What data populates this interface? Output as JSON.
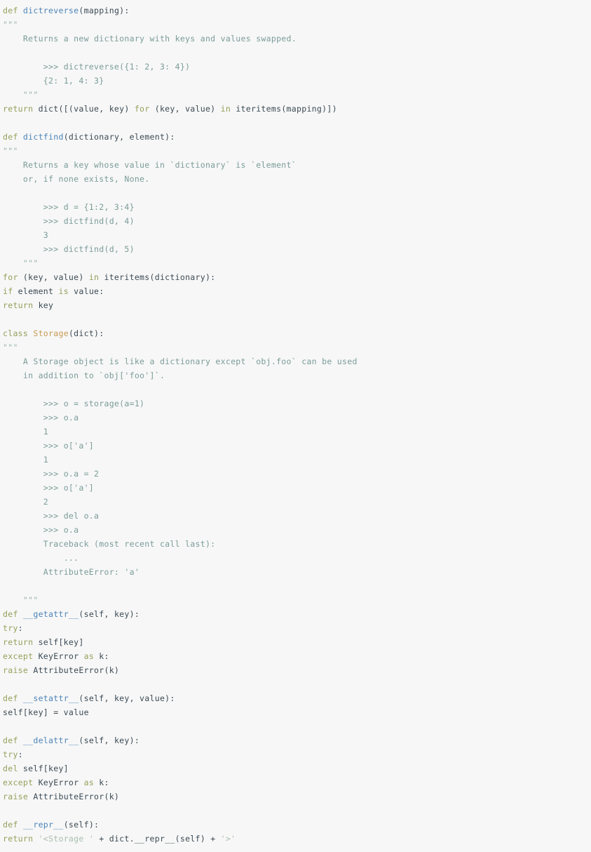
{
  "view": {
    "kind": "source-code-listing",
    "language": "python",
    "background_color": "#f7f7f7",
    "font_size_px": 11.5,
    "line_height_px": 20
  },
  "palette": {
    "keyword": "#94a15b",
    "function_name": "#4c84b8",
    "class_name": "#c99a53",
    "docstring": "#7a9c98",
    "triple_quote": "#9bb3b0",
    "string": "#a9bfae",
    "plain": "#3b4a54",
    "background": "#f7f7f7"
  },
  "code": {
    "lines": [
      {
        "id": 1,
        "indent": 0,
        "tokens": [
          {
            "t": "def",
            "c": "kw"
          },
          {
            "t": " ",
            "c": "pl"
          },
          {
            "t": "dictreverse",
            "c": "fn"
          },
          {
            "t": "(mapping):",
            "c": "pl"
          }
        ]
      },
      {
        "id": 2,
        "indent": 0,
        "tokens": [
          {
            "t": "\"\"\"",
            "c": "dq"
          }
        ]
      },
      {
        "id": 3,
        "indent": 4,
        "tokens": [
          {
            "t": "Returns a new dictionary with keys and values swapped.",
            "c": "doc"
          }
        ]
      },
      {
        "id": 4,
        "indent": 0,
        "tokens": []
      },
      {
        "id": 5,
        "indent": 8,
        "tokens": [
          {
            "t": ">>> dictreverse({1: 2, 3: 4})",
            "c": "doc"
          }
        ]
      },
      {
        "id": 6,
        "indent": 8,
        "tokens": [
          {
            "t": "{2: 1, 4: 3}",
            "c": "doc"
          }
        ]
      },
      {
        "id": 7,
        "indent": 4,
        "tokens": [
          {
            "t": "\"\"\"",
            "c": "dq"
          }
        ]
      },
      {
        "id": 8,
        "indent": 0,
        "tokens": [
          {
            "t": "return",
            "c": "kw"
          },
          {
            "t": " dict([(value, key) ",
            "c": "pl"
          },
          {
            "t": "for",
            "c": "kw"
          },
          {
            "t": " (key, value) ",
            "c": "pl"
          },
          {
            "t": "in",
            "c": "kw"
          },
          {
            "t": " iteritems(mapping)])",
            "c": "pl"
          }
        ]
      },
      {
        "id": 9,
        "indent": 0,
        "tokens": []
      },
      {
        "id": 10,
        "indent": 0,
        "tokens": [
          {
            "t": "def",
            "c": "kw"
          },
          {
            "t": " ",
            "c": "pl"
          },
          {
            "t": "dictfind",
            "c": "fn"
          },
          {
            "t": "(dictionary, element):",
            "c": "pl"
          }
        ]
      },
      {
        "id": 11,
        "indent": 0,
        "tokens": [
          {
            "t": "\"\"\"",
            "c": "dq"
          }
        ]
      },
      {
        "id": 12,
        "indent": 4,
        "tokens": [
          {
            "t": "Returns a key whose value in `dictionary` is `element`",
            "c": "doc"
          }
        ]
      },
      {
        "id": 13,
        "indent": 4,
        "tokens": [
          {
            "t": "or, if none exists, None.",
            "c": "doc"
          }
        ]
      },
      {
        "id": 14,
        "indent": 0,
        "tokens": []
      },
      {
        "id": 15,
        "indent": 8,
        "tokens": [
          {
            "t": ">>> d = {1:2, 3:4}",
            "c": "doc"
          }
        ]
      },
      {
        "id": 16,
        "indent": 8,
        "tokens": [
          {
            "t": ">>> dictfind(d, 4)",
            "c": "doc"
          }
        ]
      },
      {
        "id": 17,
        "indent": 8,
        "tokens": [
          {
            "t": "3",
            "c": "doc"
          }
        ]
      },
      {
        "id": 18,
        "indent": 8,
        "tokens": [
          {
            "t": ">>> dictfind(d, 5)",
            "c": "doc"
          }
        ]
      },
      {
        "id": 19,
        "indent": 4,
        "tokens": [
          {
            "t": "\"\"\"",
            "c": "dq"
          }
        ]
      },
      {
        "id": 20,
        "indent": 0,
        "tokens": [
          {
            "t": "for",
            "c": "kw"
          },
          {
            "t": " (key, value) ",
            "c": "pl"
          },
          {
            "t": "in",
            "c": "kw"
          },
          {
            "t": " iteritems(dictionary):",
            "c": "pl"
          }
        ]
      },
      {
        "id": 21,
        "indent": 0,
        "tokens": [
          {
            "t": "if",
            "c": "kw"
          },
          {
            "t": " element ",
            "c": "pl"
          },
          {
            "t": "is",
            "c": "kw"
          },
          {
            "t": " value:",
            "c": "pl"
          }
        ]
      },
      {
        "id": 22,
        "indent": 0,
        "tokens": [
          {
            "t": "return",
            "c": "kw"
          },
          {
            "t": " key",
            "c": "pl"
          }
        ]
      },
      {
        "id": 23,
        "indent": 0,
        "tokens": []
      },
      {
        "id": 24,
        "indent": 0,
        "tokens": [
          {
            "t": "class",
            "c": "kw"
          },
          {
            "t": " ",
            "c": "pl"
          },
          {
            "t": "Storage",
            "c": "cls"
          },
          {
            "t": "(dict):",
            "c": "pl"
          }
        ]
      },
      {
        "id": 25,
        "indent": 0,
        "tokens": [
          {
            "t": "\"\"\"",
            "c": "dq"
          }
        ]
      },
      {
        "id": 26,
        "indent": 4,
        "tokens": [
          {
            "t": "A Storage object is like a dictionary except `obj.foo` can be used",
            "c": "doc"
          }
        ]
      },
      {
        "id": 27,
        "indent": 4,
        "tokens": [
          {
            "t": "in addition to `obj['foo']`.",
            "c": "doc"
          }
        ]
      },
      {
        "id": 28,
        "indent": 0,
        "tokens": []
      },
      {
        "id": 29,
        "indent": 8,
        "tokens": [
          {
            "t": ">>> o = storage(a=1)",
            "c": "doc"
          }
        ]
      },
      {
        "id": 30,
        "indent": 8,
        "tokens": [
          {
            "t": ">>> o.a",
            "c": "doc"
          }
        ]
      },
      {
        "id": 31,
        "indent": 8,
        "tokens": [
          {
            "t": "1",
            "c": "doc"
          }
        ]
      },
      {
        "id": 32,
        "indent": 8,
        "tokens": [
          {
            "t": ">>> o['a']",
            "c": "doc"
          }
        ]
      },
      {
        "id": 33,
        "indent": 8,
        "tokens": [
          {
            "t": "1",
            "c": "doc"
          }
        ]
      },
      {
        "id": 34,
        "indent": 8,
        "tokens": [
          {
            "t": ">>> o.a = 2",
            "c": "doc"
          }
        ]
      },
      {
        "id": 35,
        "indent": 8,
        "tokens": [
          {
            "t": ">>> o['a']",
            "c": "doc"
          }
        ]
      },
      {
        "id": 36,
        "indent": 8,
        "tokens": [
          {
            "t": "2",
            "c": "doc"
          }
        ]
      },
      {
        "id": 37,
        "indent": 8,
        "tokens": [
          {
            "t": ">>> del o.a",
            "c": "doc"
          }
        ]
      },
      {
        "id": 38,
        "indent": 8,
        "tokens": [
          {
            "t": ">>> o.a",
            "c": "doc"
          }
        ]
      },
      {
        "id": 39,
        "indent": 8,
        "tokens": [
          {
            "t": "Traceback (most recent call last):",
            "c": "doc"
          }
        ]
      },
      {
        "id": 40,
        "indent": 12,
        "tokens": [
          {
            "t": "...",
            "c": "doc"
          }
        ]
      },
      {
        "id": 41,
        "indent": 8,
        "tokens": [
          {
            "t": "AttributeError: 'a'",
            "c": "doc"
          }
        ]
      },
      {
        "id": 42,
        "indent": 0,
        "tokens": []
      },
      {
        "id": 43,
        "indent": 4,
        "tokens": [
          {
            "t": "\"\"\"",
            "c": "dq"
          }
        ]
      },
      {
        "id": 44,
        "indent": 0,
        "tokens": [
          {
            "t": "def",
            "c": "kw"
          },
          {
            "t": " ",
            "c": "pl"
          },
          {
            "t": "__getattr__",
            "c": "fn"
          },
          {
            "t": "(self, key):",
            "c": "pl"
          }
        ]
      },
      {
        "id": 45,
        "indent": 0,
        "tokens": [
          {
            "t": "try",
            "c": "kw"
          },
          {
            "t": ":",
            "c": "pl"
          }
        ]
      },
      {
        "id": 46,
        "indent": 0,
        "tokens": [
          {
            "t": "return",
            "c": "kw"
          },
          {
            "t": " self[key]",
            "c": "pl"
          }
        ]
      },
      {
        "id": 47,
        "indent": 0,
        "tokens": [
          {
            "t": "except",
            "c": "kw"
          },
          {
            "t": " KeyError ",
            "c": "pl"
          },
          {
            "t": "as",
            "c": "kw"
          },
          {
            "t": " k:",
            "c": "pl"
          }
        ]
      },
      {
        "id": 48,
        "indent": 0,
        "tokens": [
          {
            "t": "raise",
            "c": "kw"
          },
          {
            "t": " AttributeError(k)",
            "c": "pl"
          }
        ]
      },
      {
        "id": 49,
        "indent": 0,
        "tokens": []
      },
      {
        "id": 50,
        "indent": 0,
        "tokens": [
          {
            "t": "def",
            "c": "kw"
          },
          {
            "t": " ",
            "c": "pl"
          },
          {
            "t": "__setattr__",
            "c": "fn"
          },
          {
            "t": "(self, key, value):",
            "c": "pl"
          }
        ]
      },
      {
        "id": 51,
        "indent": 0,
        "tokens": [
          {
            "t": "self[key] = value",
            "c": "pl"
          }
        ]
      },
      {
        "id": 52,
        "indent": 0,
        "tokens": []
      },
      {
        "id": 53,
        "indent": 0,
        "tokens": [
          {
            "t": "def",
            "c": "kw"
          },
          {
            "t": " ",
            "c": "pl"
          },
          {
            "t": "__delattr__",
            "c": "fn"
          },
          {
            "t": "(self, key):",
            "c": "pl"
          }
        ]
      },
      {
        "id": 54,
        "indent": 0,
        "tokens": [
          {
            "t": "try",
            "c": "kw"
          },
          {
            "t": ":",
            "c": "pl"
          }
        ]
      },
      {
        "id": 55,
        "indent": 0,
        "tokens": [
          {
            "t": "del",
            "c": "kw"
          },
          {
            "t": " self[key]",
            "c": "pl"
          }
        ]
      },
      {
        "id": 56,
        "indent": 0,
        "tokens": [
          {
            "t": "except",
            "c": "kw"
          },
          {
            "t": " KeyError ",
            "c": "pl"
          },
          {
            "t": "as",
            "c": "kw"
          },
          {
            "t": " k:",
            "c": "pl"
          }
        ]
      },
      {
        "id": 57,
        "indent": 0,
        "tokens": [
          {
            "t": "raise",
            "c": "kw"
          },
          {
            "t": " AttributeError(k)",
            "c": "pl"
          }
        ]
      },
      {
        "id": 58,
        "indent": 0,
        "tokens": []
      },
      {
        "id": 59,
        "indent": 0,
        "tokens": [
          {
            "t": "def",
            "c": "kw"
          },
          {
            "t": " ",
            "c": "pl"
          },
          {
            "t": "__repr__",
            "c": "fn"
          },
          {
            "t": "(self):",
            "c": "pl"
          }
        ]
      },
      {
        "id": 60,
        "indent": 0,
        "tokens": [
          {
            "t": "return",
            "c": "kw"
          },
          {
            "t": " ",
            "c": "pl"
          },
          {
            "t": "'<Storage '",
            "c": "str"
          },
          {
            "t": " + dict.__repr__(self) + ",
            "c": "pl"
          },
          {
            "t": "'>'",
            "c": "str"
          }
        ]
      }
    ]
  }
}
